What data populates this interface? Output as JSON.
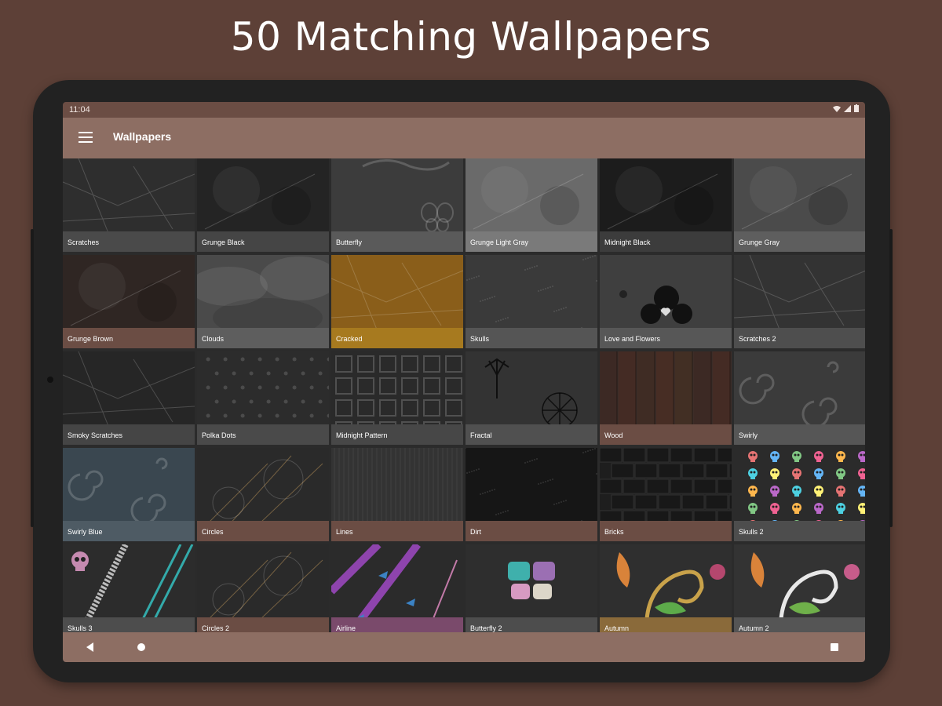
{
  "headline": "50 Matching Wallpapers",
  "status": {
    "time": "11:04",
    "icons": [
      "wifi-icon",
      "signal-icon",
      "battery-icon"
    ]
  },
  "appbar": {
    "menu_icon": "hamburger-menu-icon",
    "title": "Wallpapers"
  },
  "colors": {
    "background": "#5d4037",
    "appbar": "#8d6e63",
    "statusbar": "#6b4d44",
    "tablet_frame": "#222222"
  },
  "wallpapers": [
    {
      "label": "Scratches",
      "base": "#2e2e2e",
      "band": "#4a4a4a",
      "motif": "lines"
    },
    {
      "label": "Grunge Black",
      "base": "#242424",
      "band": "#454545",
      "motif": "grunge"
    },
    {
      "label": "Butterfly",
      "base": "#3c3c3c",
      "band": "#5a5a5a",
      "motif": "butterfly"
    },
    {
      "label": "Grunge Light Gray",
      "base": "#6a6a6a",
      "band": "#7a7a7a",
      "motif": "grunge"
    },
    {
      "label": "Midnight Black",
      "base": "#1c1c1c",
      "band": "#3c3c3c",
      "motif": "grunge"
    },
    {
      "label": "Grunge Gray",
      "base": "#4b4b4b",
      "band": "#5e5e5e",
      "motif": "grunge"
    },
    {
      "label": "Grunge Brown",
      "base": "#2f2623",
      "band": "#6b4d44",
      "motif": "grunge"
    },
    {
      "label": "Clouds",
      "base": "#4a4a4a",
      "band": "#5e5e5e",
      "motif": "clouds"
    },
    {
      "label": "Cracked",
      "base": "#8a5e1a",
      "band": "#a77a1f",
      "motif": "lines"
    },
    {
      "label": "Skulls",
      "base": "#3a3a3a",
      "band": "#555555",
      "motif": "grain"
    },
    {
      "label": "Love and Flowers",
      "base": "#3f3f3f",
      "band": "#575757",
      "motif": "flower"
    },
    {
      "label": "Scratches 2",
      "base": "#333333",
      "band": "#4e4e4e",
      "motif": "lines"
    },
    {
      "label": "Smoky Scratches",
      "base": "#262626",
      "band": "#454545",
      "motif": "lines"
    },
    {
      "label": "Polka Dots",
      "base": "#2c2c2c",
      "band": "#4a4a4a",
      "motif": "dots"
    },
    {
      "label": "Midnight Pattern",
      "base": "#2a2a2a",
      "band": "#474747",
      "motif": "squares"
    },
    {
      "label": "Fractal",
      "base": "#333333",
      "band": "#505050",
      "motif": "fractal"
    },
    {
      "label": "Wood",
      "base": "#3d2d28",
      "band": "#6b4d44",
      "motif": "wood"
    },
    {
      "label": "Swirly",
      "base": "#3b3b3b",
      "band": "#565656",
      "motif": "swirl"
    },
    {
      "label": "Swirly Blue",
      "base": "#3a4750",
      "band": "#4e5b64",
      "motif": "swirl"
    },
    {
      "label": "Circles",
      "base": "#2a2a2a",
      "band": "#6b4d44",
      "motif": "circles"
    },
    {
      "label": "Lines",
      "base": "#333333",
      "band": "#6b4d44",
      "motif": "vlines"
    },
    {
      "label": "Dirt",
      "base": "#161616",
      "band": "#6b4d44",
      "motif": "grain"
    },
    {
      "label": "Bricks",
      "base": "#1e1e1e",
      "band": "#6b4d44",
      "motif": "bricks"
    },
    {
      "label": "Skulls 2",
      "base": "#2b2b2b",
      "band": "#4d4d4d",
      "motif": "skulls"
    },
    {
      "label": "Skulls 3",
      "base": "#2c2c2c",
      "band": "#4d4d4d",
      "motif": "skullstripe"
    },
    {
      "label": "Circles 2",
      "base": "#2a2a2a",
      "band": "#6b4d44",
      "motif": "circles"
    },
    {
      "label": "Airline",
      "base": "#2b2b2b",
      "band": "#7a4a6b",
      "motif": "airline"
    },
    {
      "label": "Butterfly 2",
      "base": "#2e2e2e",
      "band": "#4d4d4d",
      "motif": "butterfly2"
    },
    {
      "label": "Autumn",
      "base": "#2f2f2f",
      "band": "#8a6a3a",
      "motif": "vine"
    },
    {
      "label": "Autumn 2",
      "base": "#333333",
      "band": "#555555",
      "motif": "vine2"
    }
  ]
}
